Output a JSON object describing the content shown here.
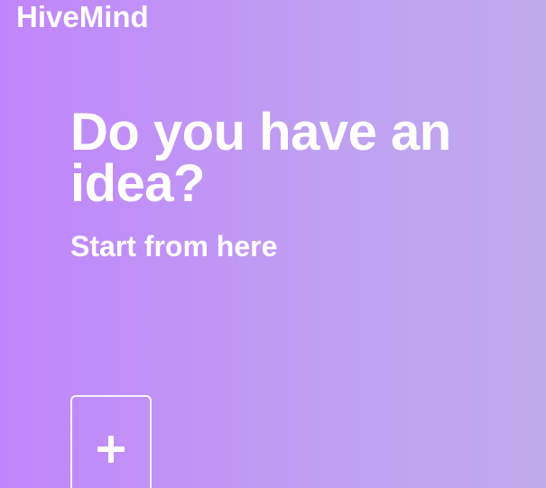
{
  "brand": {
    "name": "HiveMind"
  },
  "hero": {
    "headline": "Do you have an idea?",
    "subtitle": "Start from here"
  },
  "actions": {
    "add_card_icon": "plus-icon"
  },
  "colors": {
    "background_start": "#c185fb",
    "background_end": "#bfaaec",
    "text": "#ffffff"
  }
}
